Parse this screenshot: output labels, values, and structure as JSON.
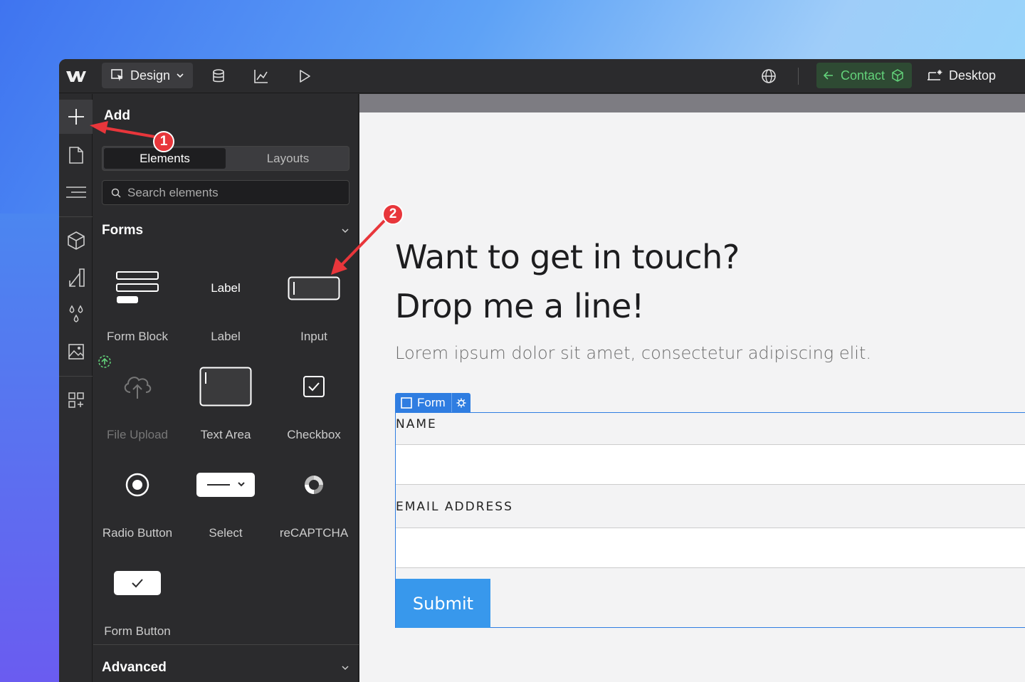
{
  "topbar": {
    "design_label": "Design",
    "contact_label": "Contact",
    "desktop_label": "Desktop"
  },
  "panel": {
    "title": "Add",
    "tabs": [
      {
        "label": "Elements",
        "active": true
      },
      {
        "label": "Layouts",
        "active": false
      }
    ],
    "search_placeholder": "Search elements",
    "forms_section": "Forms",
    "advanced_section": "Advanced",
    "elements": [
      {
        "label": "Form Block",
        "icon": "form-block-icon"
      },
      {
        "label": "Label",
        "icon": "label-icon",
        "icon_text": "Label"
      },
      {
        "label": "Input",
        "icon": "input-icon"
      },
      {
        "label": "File Upload",
        "icon": "upload-cloud-icon"
      },
      {
        "label": "Text Area",
        "icon": "text-area-icon"
      },
      {
        "label": "Checkbox",
        "icon": "checkbox-icon"
      },
      {
        "label": "Radio Button",
        "icon": "radio-icon"
      },
      {
        "label": "Select",
        "icon": "select-icon"
      },
      {
        "label": "reCAPTCHA",
        "icon": "recaptcha-icon"
      },
      {
        "label": "Form Button",
        "icon": "form-button-icon"
      }
    ]
  },
  "canvas": {
    "heading_line1": "Want to get in touch?",
    "heading_line2": "Drop me a line!",
    "lorem": "Lorem ipsum dolor sit amet, consectetur adipiscing elit.",
    "form_badge": "Form",
    "name_label": "NAME",
    "email_label": "EMAIL ADDRESS",
    "submit_label": "Submit"
  },
  "annotations": {
    "marker1": "1",
    "marker2": "2"
  },
  "colors": {
    "accent_blue": "#2f7de1",
    "submit_blue": "#3898ec",
    "contact_green": "#63d27a",
    "marker_red": "#e8363b"
  }
}
